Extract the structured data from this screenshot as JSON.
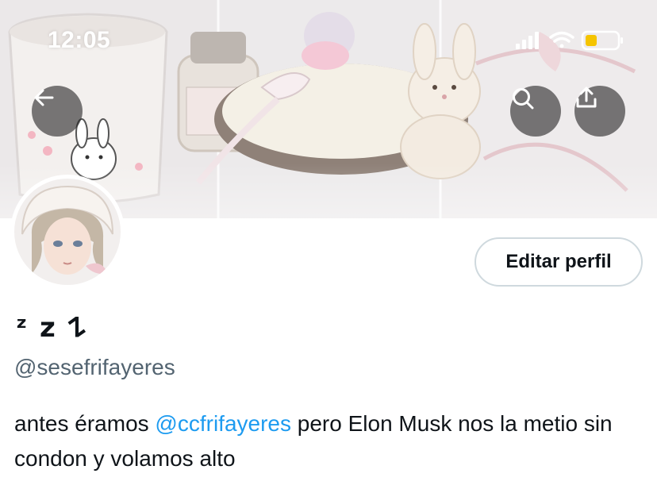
{
  "status_bar": {
    "time": "12:05"
  },
  "header": {
    "back_icon": "arrow-left-icon",
    "search_icon": "search-icon",
    "share_icon": "share-upload-icon"
  },
  "profile": {
    "display_name": "ᶻ z 𐰁",
    "handle": "@sesefrifayeres",
    "edit_button_label": "Editar perfil",
    "bio": {
      "before": "antes éramos ",
      "mention": "@ccfrifayeres",
      "after": " pero Elon Musk nos la metio sin condon y volamos alto"
    }
  },
  "colors": {
    "mention": "#1d9bf0",
    "handle": "#536471",
    "text": "#0f1419",
    "button_border": "#cfd9de",
    "battery": "#f5c400"
  }
}
